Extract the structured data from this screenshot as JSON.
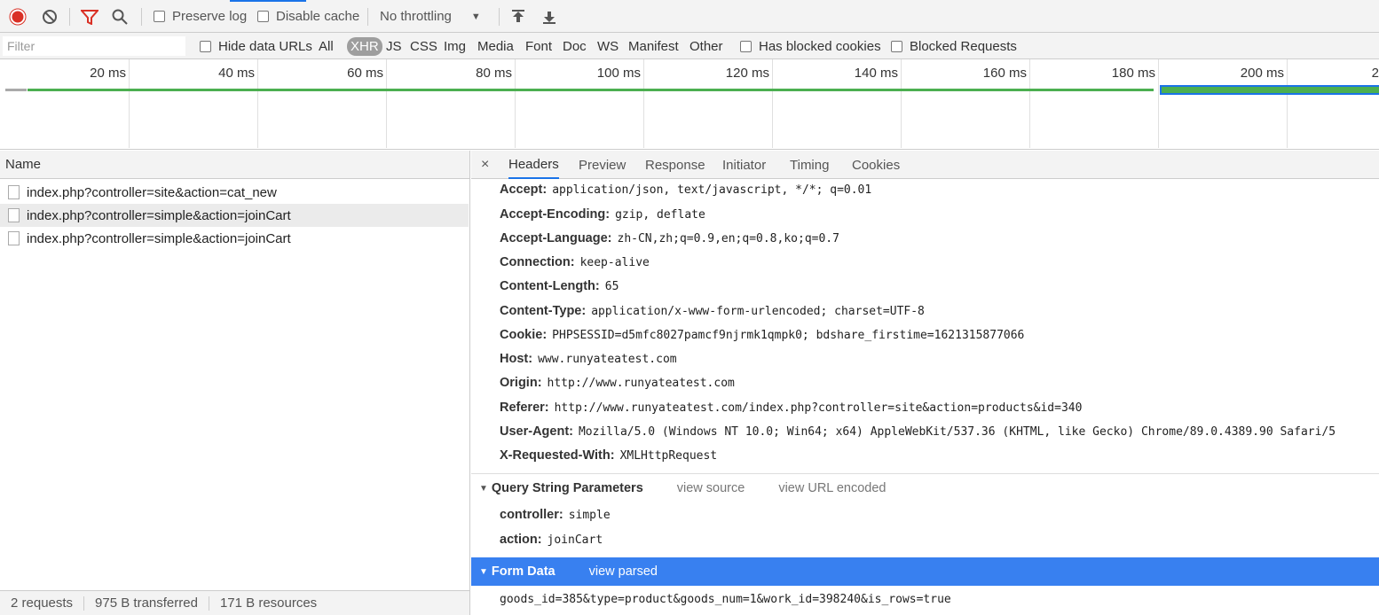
{
  "toolbar": {
    "preserve_log": "Preserve log",
    "disable_cache": "Disable cache",
    "throttling": "No throttling"
  },
  "filterbar": {
    "placeholder": "Filter",
    "hide_data_urls": "Hide data URLs",
    "types": [
      "All",
      "XHR",
      "JS",
      "CSS",
      "Img",
      "Media",
      "Font",
      "Doc",
      "WS",
      "Manifest",
      "Other"
    ],
    "selected_type": "XHR",
    "has_blocked_cookies": "Has blocked cookies",
    "blocked_requests": "Blocked Requests"
  },
  "overview": {
    "ticks": [
      "20 ms",
      "40 ms",
      "60 ms",
      "80 ms",
      "100 ms",
      "120 ms",
      "140 ms",
      "160 ms",
      "180 ms",
      "200 ms",
      "2"
    ]
  },
  "requests": {
    "column": "Name",
    "items": [
      "index.php?controller=site&action=cat_new",
      "index.php?controller=simple&action=joinCart",
      "index.php?controller=simple&action=joinCart"
    ]
  },
  "status": {
    "requests": "2 requests",
    "transferred": "975 B transferred",
    "resources": "171 B resources"
  },
  "detail": {
    "close": "×",
    "tabs": [
      "Headers",
      "Preview",
      "Response",
      "Initiator",
      "Timing",
      "Cookies"
    ],
    "headers": [
      {
        "k": "Accept:",
        "v": "application/json, text/javascript, */*; q=0.01"
      },
      {
        "k": "Accept-Encoding:",
        "v": "gzip, deflate"
      },
      {
        "k": "Accept-Language:",
        "v": "zh-CN,zh;q=0.9,en;q=0.8,ko;q=0.7"
      },
      {
        "k": "Connection:",
        "v": "keep-alive"
      },
      {
        "k": "Content-Length:",
        "v": "65"
      },
      {
        "k": "Content-Type:",
        "v": "application/x-www-form-urlencoded; charset=UTF-8"
      },
      {
        "k": "Cookie:",
        "v": "PHPSESSID=d5mfc8027pamcf9njrmk1qmpk0; bdshare_firstime=1621315877066"
      },
      {
        "k": "Host:",
        "v": "www.runyateatest.com"
      },
      {
        "k": "Origin:",
        "v": "http://www.runyateatest.com"
      },
      {
        "k": "Referer:",
        "v": "http://www.runyateatest.com/index.php?controller=site&action=products&id=340"
      },
      {
        "k": "User-Agent:",
        "v": "Mozilla/5.0 (Windows NT 10.0; Win64; x64) AppleWebKit/537.36 (KHTML, like Gecko) Chrome/89.0.4389.90 Safari/5"
      },
      {
        "k": "X-Requested-With:",
        "v": "XMLHttpRequest"
      }
    ],
    "query": {
      "title": "Query String Parameters",
      "view_source": "view source",
      "view_url_encoded": "view URL encoded",
      "params": [
        {
          "k": "controller:",
          "v": "simple"
        },
        {
          "k": "action:",
          "v": "joinCart"
        }
      ]
    },
    "form": {
      "title": "Form Data",
      "view_parsed": "view parsed",
      "body": "goods_id=385&type=product&goods_num=1&work_id=398240&is_rows=true"
    }
  },
  "colors": {
    "record": "#d93025",
    "filter": "#d93025",
    "accent": "#1a73e8",
    "form_bar": "#3880f0",
    "timeline": "#4caf50"
  }
}
